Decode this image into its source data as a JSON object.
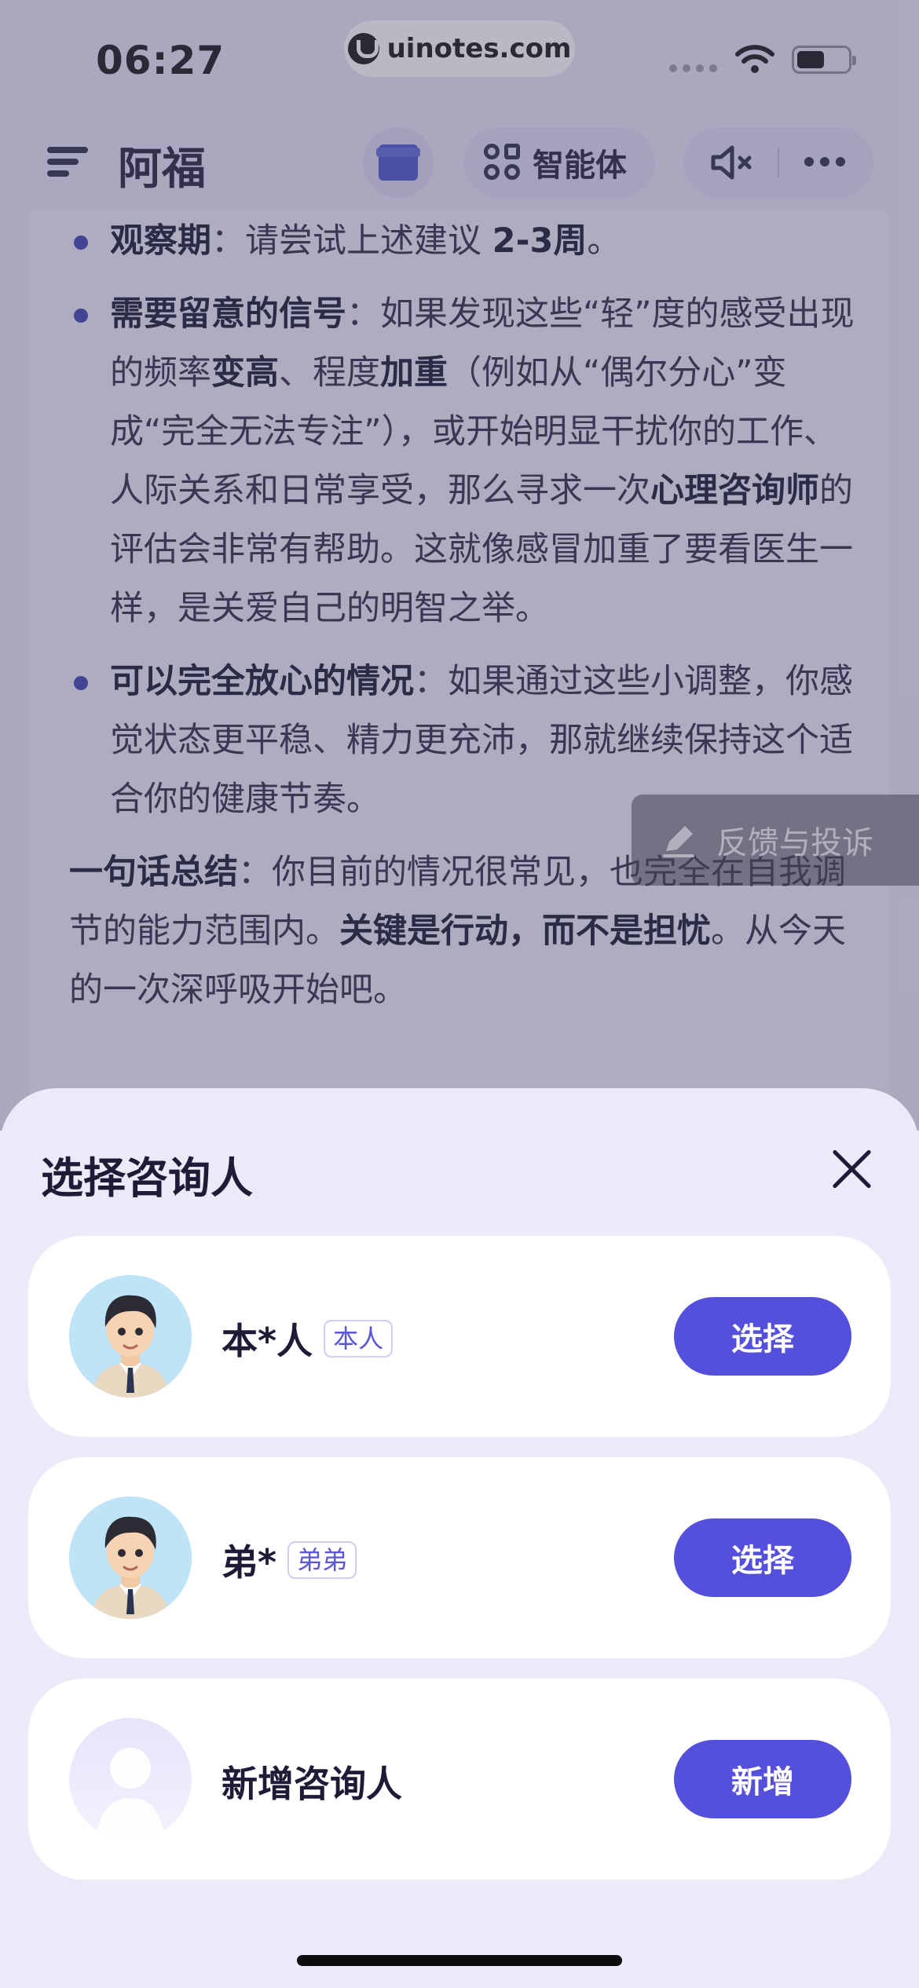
{
  "status_bar": {
    "time": "06:27",
    "watermark": "uinotes.com"
  },
  "nav": {
    "title": "阿福",
    "agent_label": "智能体"
  },
  "content": {
    "bullets": [
      {
        "segments": [
          {
            "text": "观察期",
            "bold": true
          },
          {
            "text": "：请尝试上述建议 ",
            "bold": false
          },
          {
            "text": "2-3周",
            "bold": true
          },
          {
            "text": "。",
            "bold": false
          }
        ]
      },
      {
        "segments": [
          {
            "text": "需要留意的信号",
            "bold": true
          },
          {
            "text": "：如果发现这些“轻”度的感受出现的频率",
            "bold": false
          },
          {
            "text": "变高",
            "bold": true
          },
          {
            "text": "、程度",
            "bold": false
          },
          {
            "text": "加重",
            "bold": true
          },
          {
            "text": "（例如从“偶尔分心”变成“完全无法专注”），或开始明显干扰你的工作、人际关系和日常享受，那么寻求一次",
            "bold": false
          },
          {
            "text": "心理咨询师",
            "bold": true
          },
          {
            "text": "的评估会非常有帮助。这就像感冒加重了要看医生一样，是关爱自己的明智之举。",
            "bold": false
          }
        ]
      },
      {
        "segments": [
          {
            "text": "可以完全放心的情况",
            "bold": true
          },
          {
            "text": "：如果通过这些小调整，你感觉状态更平稳、精力更充沛，那就继续保持这个适合你的健康节奏。",
            "bold": false
          }
        ]
      }
    ],
    "summary": {
      "segments": [
        {
          "text": "一句话总结",
          "bold": true
        },
        {
          "text": "：你目前的情况很常见，也完全在自我调节的能力范围内。",
          "bold": false
        },
        {
          "text": "关键是行动，而不是担忧",
          "bold": true
        },
        {
          "text": "。从今天的一次深呼吸开始吧。",
          "bold": false
        }
      ]
    }
  },
  "feedback": {
    "label": "反馈与投诉"
  },
  "sheet": {
    "title": "选择咨询人",
    "persons": [
      {
        "name": "本*人",
        "tag": "本人",
        "button": "选择"
      },
      {
        "name": "弟*",
        "tag": "弟弟",
        "button": "选择"
      }
    ],
    "add": {
      "name": "新增咨询人",
      "button": "新增"
    }
  },
  "colors": {
    "accent": "#5450dc",
    "bullet": "#3b3fb0",
    "sheet_bg": "#eceaf9"
  }
}
